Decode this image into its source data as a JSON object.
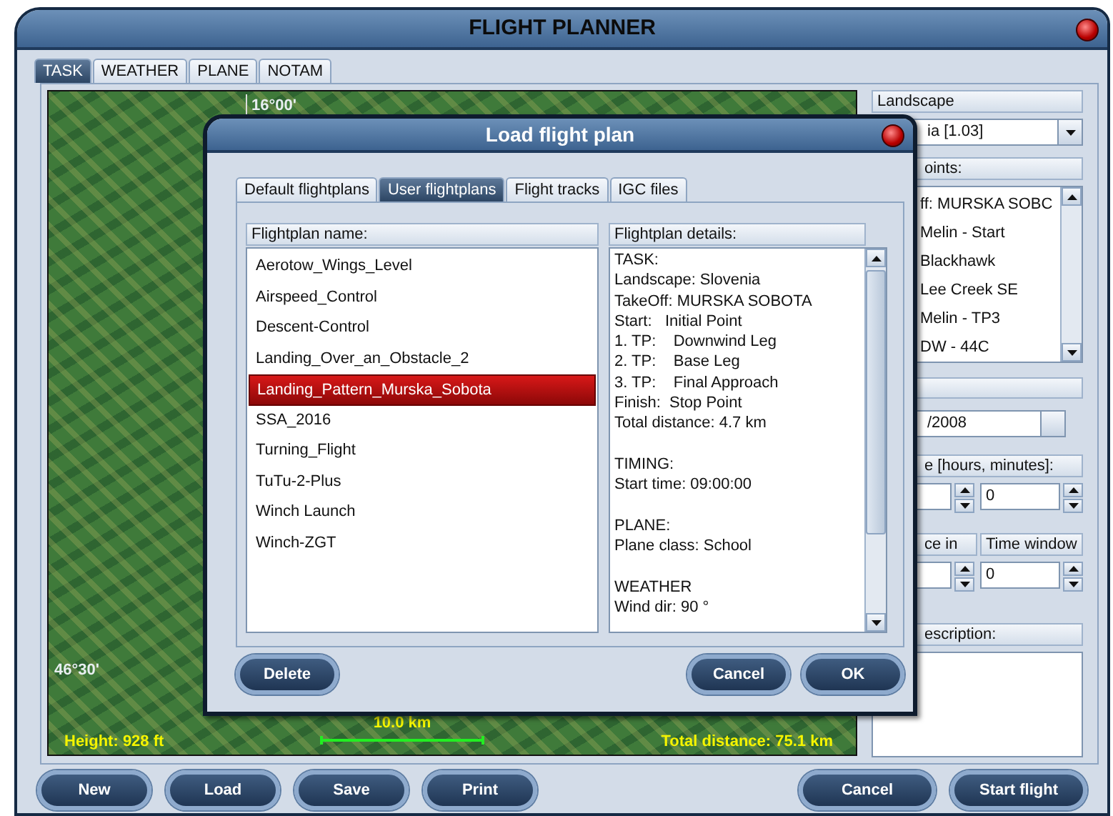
{
  "window": {
    "title": "FLIGHT PLANNER"
  },
  "tabs": [
    {
      "label": "TASK",
      "selected": true
    },
    {
      "label": "WEATHER",
      "selected": false
    },
    {
      "label": "PLANE",
      "selected": false
    },
    {
      "label": "NOTAM",
      "selected": false
    }
  ],
  "map": {
    "longitude_label": "16°00'",
    "latitude_label": "46°30'",
    "height": "Height: 928 ft",
    "scale": "10.0 km",
    "total_distance": "Total distance: 75.1 km"
  },
  "side_panel": {
    "landscape_header": "Landscape",
    "landscape_value": "ia [1.03]",
    "turnpoints_header": "oints:",
    "turnpoints": [
      {
        "label": "ff: MURSKA SOBC"
      },
      {
        "label": "Melin - Start"
      },
      {
        "label": "Blackhawk"
      },
      {
        "label": "Lee Creek SE"
      },
      {
        "label": "Melin - TP3"
      },
      {
        "label": "DW - 44C"
      }
    ],
    "date_value": "/2008",
    "duration_header": "e [hours, minutes]:",
    "duration_minutes": "0",
    "arrival_header": "ce in",
    "time_window_header": "Time window",
    "time_window_value": "0",
    "description_header": "escription:"
  },
  "buttons": [
    {
      "label": "New",
      "kind": "left"
    },
    {
      "label": "Load",
      "kind": "left"
    },
    {
      "label": "Save",
      "kind": "left"
    },
    {
      "label": "Print",
      "kind": "left"
    },
    {
      "label": "Cancel",
      "kind": "right"
    },
    {
      "label": "Start flight",
      "kind": "right"
    }
  ],
  "dialog": {
    "title": "Load flight plan",
    "tabs": [
      {
        "label": "Default flightplans",
        "selected": false
      },
      {
        "label": "User flightplans",
        "selected": true
      },
      {
        "label": "Flight tracks",
        "selected": false
      },
      {
        "label": "IGC files",
        "selected": false
      }
    ],
    "list_header": "Flightplan name:",
    "items": [
      {
        "label": "Aerotow_Wings_Level",
        "selected": false
      },
      {
        "label": "Airspeed_Control",
        "selected": false
      },
      {
        "label": "Descent-Control",
        "selected": false
      },
      {
        "label": "Landing_Over_an_Obstacle_2",
        "selected": false
      },
      {
        "label": "Landing_Pattern_Murska_Sobota",
        "selected": true
      },
      {
        "label": "SSA_2016",
        "selected": false
      },
      {
        "label": "Turning_Flight",
        "selected": false
      },
      {
        "label": "TuTu-2-Plus",
        "selected": false
      },
      {
        "label": "Winch Launch",
        "selected": false
      },
      {
        "label": "Winch-ZGT",
        "selected": false
      }
    ],
    "details_header": "Flightplan details:",
    "details": [
      [
        "TASK:",
        "Landscape: Slovenia",
        "TakeOff: MURSKA SOBOTA",
        "Start:   Initial Point",
        "1. TP:    Downwind Leg",
        "2. TP:    Base Leg",
        "3. TP:    Final Approach",
        "Finish:  Stop Point",
        "Total distance: 4.7 km"
      ],
      [
        "TIMING:",
        "Start time: 09:00:00"
      ],
      [
        "PLANE:",
        "Plane class: School"
      ],
      [
        "WEATHER",
        "Wind dir: 90 °"
      ]
    ],
    "buttons": [
      {
        "label": "Delete",
        "kind": "left"
      },
      {
        "label": "Cancel",
        "kind": "right"
      },
      {
        "label": "OK",
        "kind": "right"
      }
    ]
  }
}
